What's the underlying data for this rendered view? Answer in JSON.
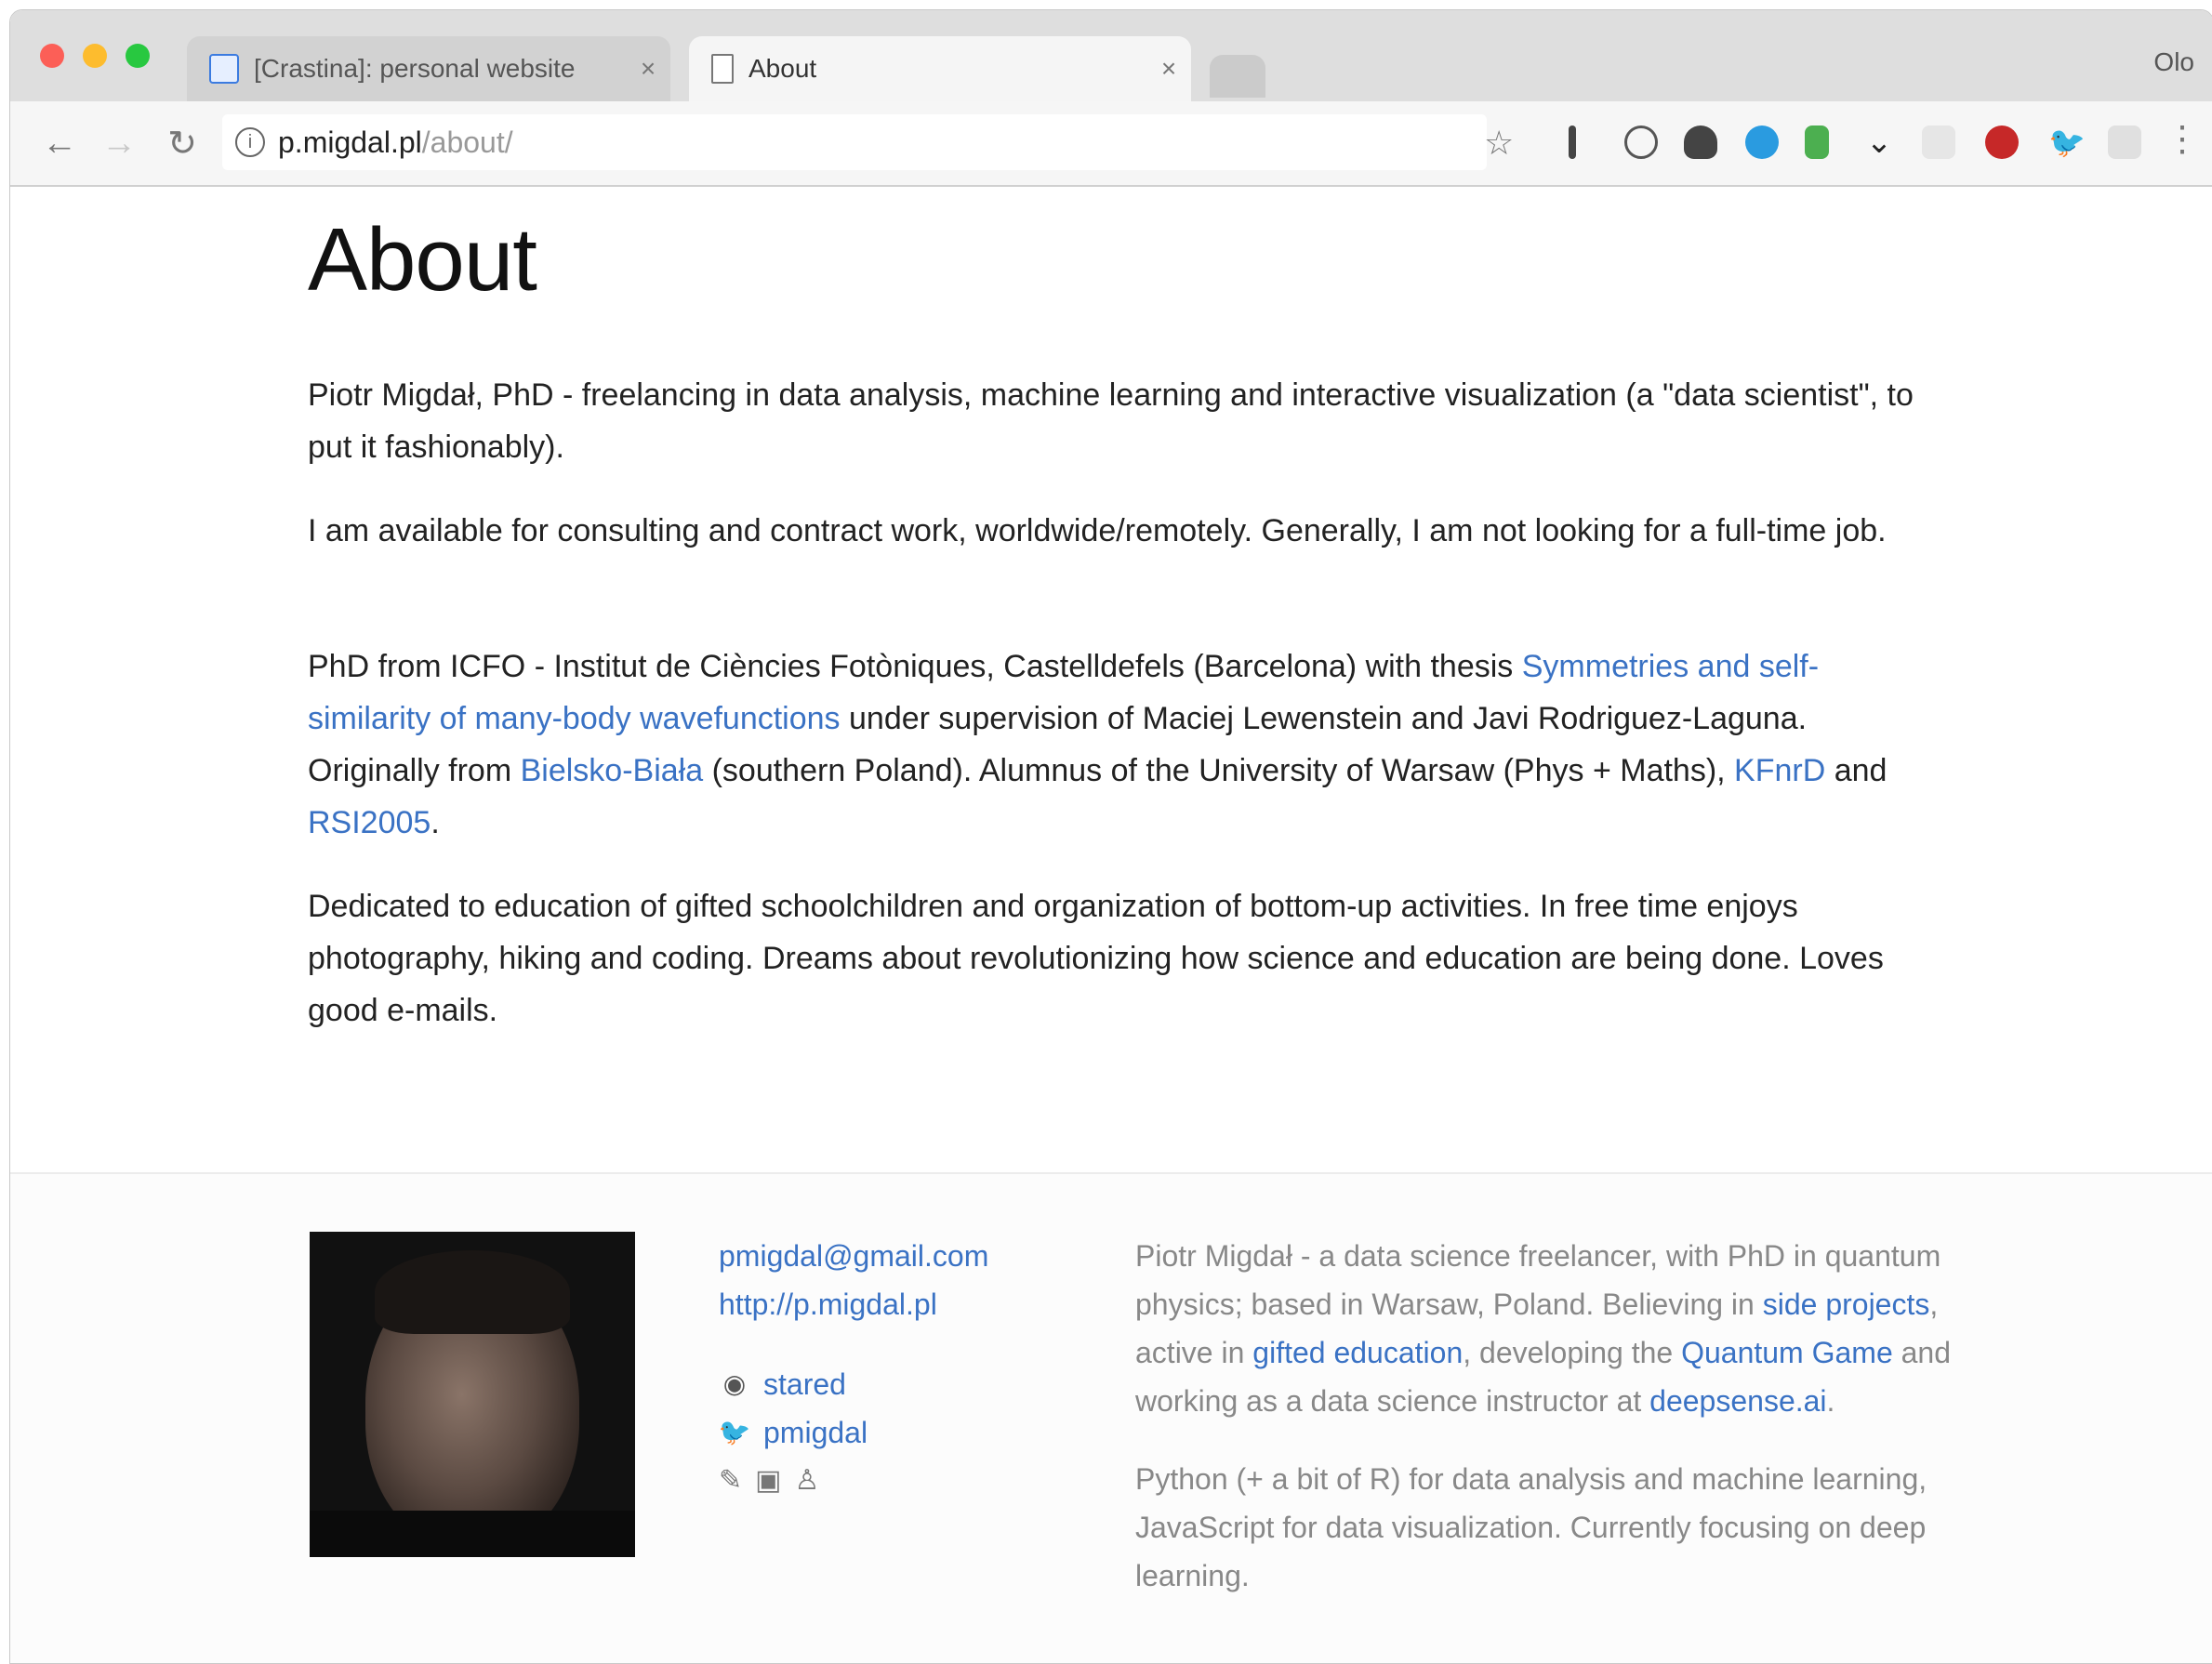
{
  "browser": {
    "tabs": [
      {
        "title": "[Crastina]: personal website",
        "active": false
      },
      {
        "title": "About",
        "active": true
      }
    ],
    "profile_label": "Olo",
    "url_host": "p.migdal.pl",
    "url_path": "/about/"
  },
  "page": {
    "heading": "About",
    "p1": "Piotr Migdał, PhD - freelancing in data analysis, machine learning and interactive visualization (a \"data scientist\", to put it fashionably).",
    "p2": "I am available for consulting and contract work, worldwide/remotely. Generally, I am not looking for a full-time job.",
    "p3": {
      "t1": "PhD from ICFO - Institut de Ciències Fotòniques, Castelldefels (Barcelona) with thesis ",
      "thesis_link": "Symmetries and self-similarity of many-body wavefunctions",
      "t2": " under supervision of Maciej Lewenstein and Javi Rodriguez-Laguna. Originally from ",
      "city_link": "Bielsko-Biała",
      "t3": " (southern Poland). Alumnus of the University of Warsaw (Phys + Maths), ",
      "kfnrd_link": "KFnrD",
      "t4": " and ",
      "rsi_link": "RSI2005",
      "t5": "."
    },
    "p4": "Dedicated to education of gifted schoolchildren and organization of bottom-up activities. In free time enjoys photography, hiking and coding. Dreams about revolutionizing how science and education are being done. Loves good e-mails."
  },
  "footer": {
    "email": "pmigdal@gmail.com",
    "website": "http://p.migdal.pl",
    "github": "stared",
    "twitter": "pmigdal",
    "bio1": {
      "t1": "Piotr Migdał - a data science freelancer, with PhD in quantum physics; based in Warsaw, Poland. Believing in ",
      "side_link": "side projects",
      "t2": ", active in ",
      "gifted_link": "gifted education",
      "t3": ", developing the ",
      "quantum_link": "Quantum Game",
      "t4": " and working as a data science instructor at ",
      "deepsense_link": "deepsense.ai",
      "t5": "."
    },
    "bio2": "Python (+ a bit of R) for data analysis and machine learning, JavaScript for data visualization. Currently focusing on deep learning."
  }
}
